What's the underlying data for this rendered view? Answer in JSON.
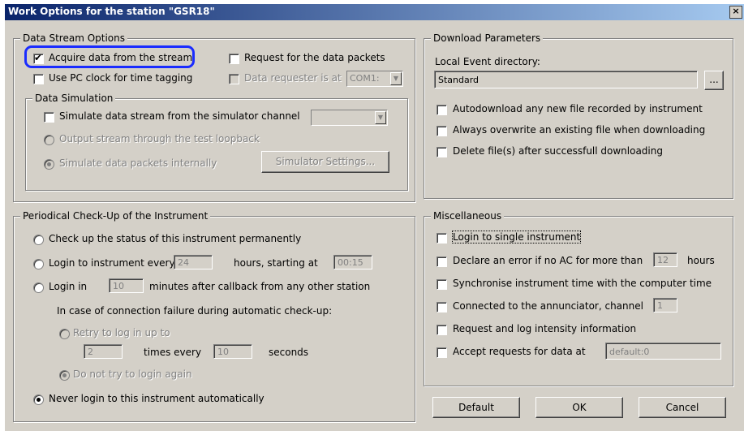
{
  "window": {
    "title": "Work Options for the station \"GSR18\"",
    "close": "×"
  },
  "data_stream": {
    "legend": "Data Stream Options",
    "acquire": "Acquire data from the stream",
    "request_packets": "Request for the data packets",
    "use_pc_clock": "Use PC clock for time tagging",
    "requester_label": "Data requester is at",
    "requester_port": "COM1:",
    "simulation": {
      "legend": "Data Simulation",
      "simulate_channel": "Simulate data stream from the simulator channel",
      "output_loopback": "Output stream through the test loopback",
      "simulate_internal": "Simulate data packets internally",
      "settings_button": "Simulator Settings..."
    }
  },
  "checkup": {
    "legend": "Periodical Check-Up of the Instrument",
    "permanent": "Check up the status of this instrument permanently",
    "login_every": "Login to instrument every",
    "every_value": "24",
    "hours_starting": "hours, starting at",
    "start_value": "00:15",
    "login_in": "Login in",
    "login_in_value": "10",
    "minutes_after": "minutes after callback from any other station",
    "failure_label": "In case of connection failure during automatic check-up:",
    "retry": "Retry to log in up to",
    "retry_value": "2",
    "times_every": "times every",
    "times_value": "10",
    "seconds": "seconds",
    "no_retry": "Do not try to login again",
    "never": "Never login to this instrument automatically"
  },
  "download": {
    "legend": "Download Parameters",
    "dir_label": "Local Event directory:",
    "dir_value": "Standard",
    "browse": "...",
    "auto": "Autodownload any new file recorded by instrument",
    "overwrite": "Always overwrite an existing file when downloading",
    "delete": "Delete file(s) after successfull downloading"
  },
  "misc": {
    "legend": "Miscellaneous",
    "single": "Login to single instrument",
    "declare": "Declare an error if no AC for more than",
    "declare_value": "12",
    "hours": "hours",
    "sync": "Synchronise instrument time with the computer time",
    "annunciator": "Connected to the annunciator, channel",
    "annunciator_value": "1",
    "intensity": "Request and log intensity information",
    "accept": "Accept requests for data at",
    "accept_value": "default:0"
  },
  "buttons": {
    "default": "Default",
    "ok": "OK",
    "cancel": "Cancel"
  },
  "colors": {
    "highlight": "#1a2cff",
    "titlebar": "#0a246a"
  }
}
